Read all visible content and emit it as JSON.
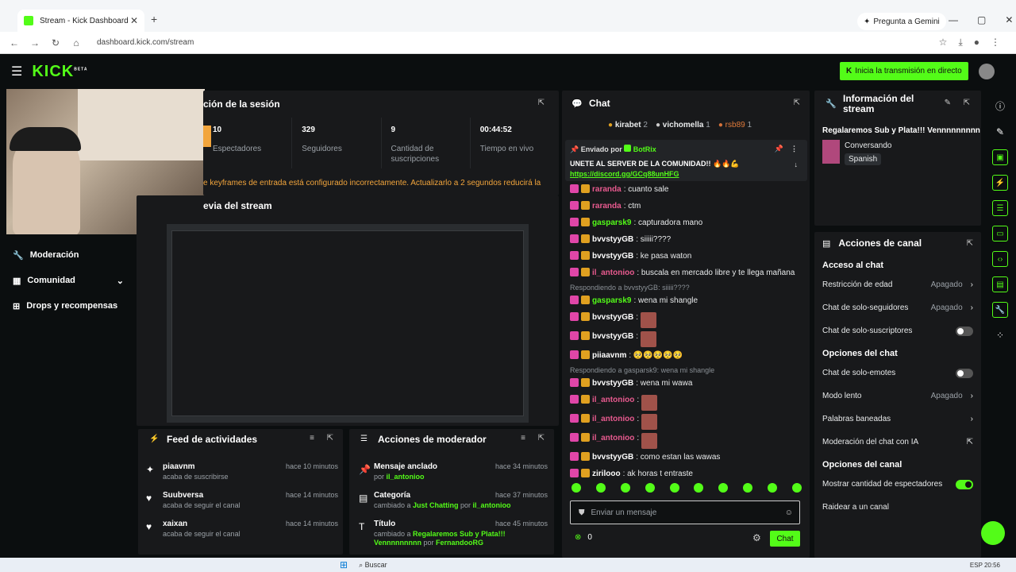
{
  "browser": {
    "tab_title": "Stream - Kick Dashboard",
    "tab_close": "✕",
    "new_tab": "+",
    "gemini_label": "Pregunta a Gemini",
    "url": "dashboard.kick.com/stream",
    "win_min": "—",
    "win_max": "▢",
    "win_close": "✕"
  },
  "topbar": {
    "logo": "KICK",
    "logo_sup": "BETA",
    "go_live": "Inicia la transmisión en directo"
  },
  "sidebar": {
    "items": [
      {
        "label": "Moderación"
      },
      {
        "label": "Comunidad"
      },
      {
        "label": "Drops y recompensas"
      }
    ]
  },
  "session": {
    "title": "ción de la sesión",
    "stats": [
      {
        "value": "10",
        "label": "Espectadores"
      },
      {
        "value": "329",
        "label": "Seguidores"
      },
      {
        "value": "9",
        "label": "Cantidad de suscripciones"
      },
      {
        "value": "00:44:52",
        "label": "Tiempo en vivo"
      }
    ],
    "warning": "e keyframes de entrada está configurado incorrectamente. Actualizarlo a 2 segundos reducirá la",
    "preview_title": "evia del stream"
  },
  "chat": {
    "title": "Chat",
    "top_gifters": [
      {
        "name": "kirabet",
        "count": "2"
      },
      {
        "name": "vichomella",
        "count": "1"
      },
      {
        "name": "rsb89",
        "count": "1"
      }
    ],
    "pinned": {
      "header": "Enviado por",
      "sender": "BotRix",
      "text": "UNETE AL SERVER DE LA COMUNIDAD!! 🔥🔥💪",
      "link": "https://discord.gg/GCq88unHFG"
    },
    "messages": [
      {
        "user": "raranda",
        "text": ": cuanto sale",
        "color": "pink"
      },
      {
        "user": "raranda",
        "text": ": ctm",
        "color": "pink"
      },
      {
        "user": "gasparsk9",
        "text": ": capturadora mano",
        "color": "green"
      },
      {
        "user": "bvvstyyGB",
        "text": ": siiiii????",
        "color": "white"
      },
      {
        "user": "bvvstyyGB",
        "text": ": ke pasa waton",
        "color": "white"
      },
      {
        "user": "il_antonioo",
        "text": ": buscala en mercado libre y te llega mañana",
        "color": "pink"
      },
      {
        "reply": "Respondiendo a bvvstyyGB: siiiii????"
      },
      {
        "user": "gasparsk9",
        "text": ": wena mi shangle",
        "color": "green"
      },
      {
        "user": "bvvstyyGB",
        "text": ":",
        "color": "white",
        "emote": true
      },
      {
        "user": "bvvstyyGB",
        "text": ":",
        "color": "white",
        "emote": true
      },
      {
        "user": "piiaavnm",
        "text": ": 🥺🥺🥺🥺🥺",
        "color": "white"
      },
      {
        "reply": "Respondiendo a gasparsk9: wena mi shangle"
      },
      {
        "user": "bvvstyyGB",
        "text": ": wena mi wawa",
        "color": "white"
      },
      {
        "user": "il_antonioo",
        "text": ":",
        "color": "pink",
        "emote": true
      },
      {
        "user": "il_antonioo",
        "text": ":",
        "color": "pink",
        "emote": true
      },
      {
        "user": "il_antonioo",
        "text": ":",
        "color": "pink",
        "emote": true
      },
      {
        "user": "bvvstyyGB",
        "text": ": como estan las wawas",
        "color": "white"
      },
      {
        "user": "zirilooo",
        "text": ": ak horas t entraste",
        "color": "white"
      }
    ],
    "input_placeholder": "Enviar un mensaje",
    "points": "0",
    "send_label": "Chat"
  },
  "stream_info": {
    "title": "Información del stream",
    "stream_title": "Regalaremos Sub y Plata!!! Vennnnnnnnn",
    "category": "Conversando",
    "language": "Spanish"
  },
  "channel_actions": {
    "title": "Acciones de canal",
    "sections": [
      {
        "heading": "Acceso al chat",
        "rows": [
          {
            "label": "Restricción de edad",
            "value": "Apagado",
            "kind": "link"
          },
          {
            "label": "Chat de solo-seguidores",
            "value": "Apagado",
            "kind": "link"
          },
          {
            "label": "Chat de solo-suscriptores",
            "value": "",
            "kind": "toggle-off"
          }
        ]
      },
      {
        "heading": "Opciones del chat",
        "rows": [
          {
            "label": "Chat de solo-emotes",
            "value": "",
            "kind": "toggle-off"
          },
          {
            "label": "Modo lento",
            "value": "Apagado",
            "kind": "link"
          },
          {
            "label": "Palabras baneadas",
            "value": "",
            "kind": "link"
          },
          {
            "label": "Moderación del chat con IA",
            "value": "",
            "kind": "external"
          }
        ]
      },
      {
        "heading": "Opciones del canal",
        "rows": [
          {
            "label": "Mostrar cantidad de espectadores",
            "value": "",
            "kind": "toggle-on"
          },
          {
            "label": "Raidear a un canal",
            "value": "",
            "kind": "none"
          }
        ]
      }
    ]
  },
  "activity_feed": {
    "title": "Feed de actividades",
    "items": [
      {
        "name": "piaavnm",
        "action": "acaba de suscribirse",
        "time": "hace 10 minutos"
      },
      {
        "name": "Suubversa",
        "action": "acaba de seguir el canal",
        "time": "hace 14 minutos"
      },
      {
        "name": "xaixan",
        "action": "acaba de seguir el canal",
        "time": "hace 14 minutos"
      }
    ]
  },
  "mod_actions": {
    "title": "Acciones de moderador",
    "items": [
      {
        "name": "Mensaje anclado",
        "pre": "por ",
        "mid": "il_antonioo",
        "post": "",
        "extra": "",
        "time": "hace 34 minutos"
      },
      {
        "name": "Categoría",
        "pre": "cambiado a ",
        "mid": "Just Chatting",
        "post": " por ",
        "extra": "il_antonioo",
        "time": "hace 37 minutos"
      },
      {
        "name": "Título",
        "pre": "cambiado a ",
        "mid": "Regalaremos Sub y Plata!!! Vennnnnnnnn",
        "post": " por ",
        "extra": "FernandooRG",
        "time": "hace 45 minutos"
      }
    ]
  },
  "taskbar": {
    "search": "Buscar",
    "tray": "ESP 20:56"
  }
}
